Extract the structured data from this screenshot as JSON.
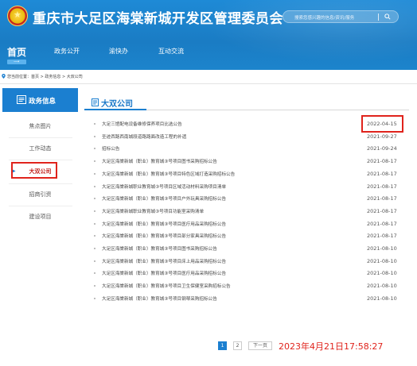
{
  "header": {
    "site_title": "重庆市大足区海棠新城开发区管理委员会",
    "search_placeholder": "搜索您感兴趣的信息/资讯/服务",
    "brand_color": "#1b7fd0"
  },
  "nav": {
    "home": "首页",
    "items": [
      "政务公开",
      "渝快办",
      "互动交流"
    ]
  },
  "breadcrumb": "您当前位置：首页 > 政务信息 > 大双公司",
  "sidebar": {
    "heading": "政务信息",
    "items": [
      {
        "label": "焦点图片",
        "active": false
      },
      {
        "label": "工作动态",
        "active": false
      },
      {
        "label": "大双公司",
        "active": true
      },
      {
        "label": "招商引资",
        "active": false
      },
      {
        "label": "建设项目",
        "active": false
      }
    ]
  },
  "content": {
    "title": "大双公司",
    "rows": [
      {
        "title": "大足三馆配电设备维修保养项目比选公告",
        "date": "2022-04-15"
      },
      {
        "title": "圣迹西路西南城段道路路面改造工程的补遗",
        "date": "2021-09-27"
      },
      {
        "title": "招标公告",
        "date": "2021-09-24"
      },
      {
        "title": "大足区海棠新城（职业）教育城③号项目图书采购招标公告",
        "date": "2021-08-17"
      },
      {
        "title": "大足区海棠新城（职业）教育城③号项目特色区域打造采购招标公告",
        "date": "2021-08-17"
      },
      {
        "title": "大足区海棠新城职业教育城③号项目区域活动材料采购项目清单",
        "date": "2021-08-17"
      },
      {
        "title": "大足区海棠新城（职业）教育城③号项目户外玩具采购招标公告",
        "date": "2021-08-17"
      },
      {
        "title": "大足区海棠新城职业教育城③号项目功能室采购清单",
        "date": "2021-08-17"
      },
      {
        "title": "大足区海棠新城（职业）教育城③号项目医疗用品采购招标公告",
        "date": "2021-08-17"
      },
      {
        "title": "大足区海棠新城（职业）教育城③号项目部分家具采购招标公告",
        "date": "2021-08-17"
      },
      {
        "title": "大足区海棠新城（职业）教育城③号项目图书采购招标公告",
        "date": "2021-08-10"
      },
      {
        "title": "大足区海棠新城（职业）教育城③号项目床上用品采购招标公告",
        "date": "2021-08-10"
      },
      {
        "title": "大足区海棠新城（职业）教育城③号项目医疗用品采购招标公告",
        "date": "2021-08-10"
      },
      {
        "title": "大足区海棠新城（职业）教育城③号项目卫生保健室采购招标公告",
        "date": "2021-08-10"
      },
      {
        "title": "大足区海棠新城（职业）教育城③号项目钢琴采购招标公告",
        "date": "2021-08-10"
      }
    ]
  },
  "pager": {
    "pages": [
      "1",
      "2"
    ],
    "current": "1",
    "next": "下一页"
  },
  "timestamp": "2023年4月21日17:58:27",
  "colors": {
    "highlight": "#e0231c",
    "accent": "#1b7fd0"
  }
}
